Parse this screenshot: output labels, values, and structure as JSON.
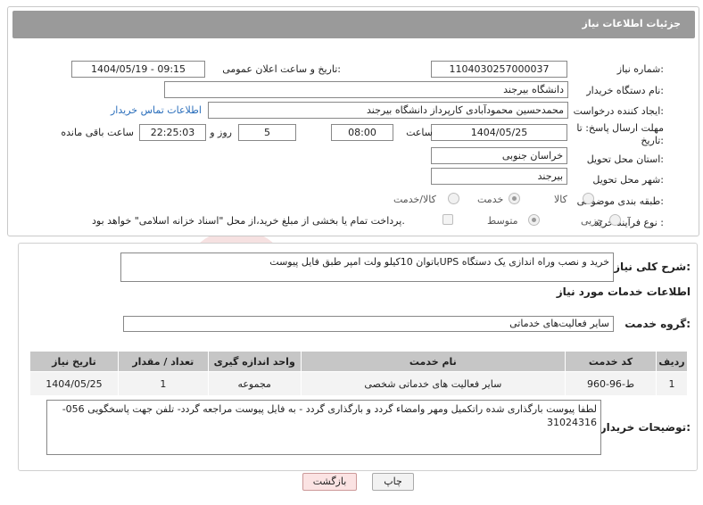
{
  "header": {
    "title": "جزئیات اطلاعات نیاز"
  },
  "labels": {
    "need_number": "شماره نیاز:",
    "public_announce": "تاریخ و ساعت اعلان عمومی:",
    "buyer_org": "نام دستگاه خریدار:",
    "requester": "ایجاد کننده درخواست:",
    "deadline": "مهلت ارسال پاسخ: تا تاریخ:",
    "time_word": "ساعت",
    "day_and": "روز و",
    "remaining": "ساعت باقی مانده",
    "province": "استان محل تحویل:",
    "city": "شهر محل تحویل:",
    "category": "طبقه بندی موضوعی:",
    "process": "نوع فرآیند خرید :"
  },
  "values": {
    "need_number": "1104030257000037",
    "public_announce": "1404/05/19 - 09:15",
    "buyer_org": "دانشگاه بیرجند",
    "requester": "محمدحسین محمودآبادی کارپرداز دانشگاه بیرجند",
    "deadline_date": "1404/05/25",
    "deadline_time": "08:00",
    "days": "5",
    "remaining_time": "22:25:03",
    "province": "خراسان جنوبی",
    "city": "بیرجند"
  },
  "contact_link": "اطلاعات تماس خریدار",
  "category_options": [
    "کالا",
    "خدمت",
    "کالا/خدمت"
  ],
  "category_selected": "خدمت",
  "process_options": [
    "جزیی",
    "متوسط"
  ],
  "process_selected": "متوسط",
  "payment_note": "پرداخت تمام یا بخشی از مبلغ خرید،از محل \"اسناد خزانه اسلامی\" خواهد بود.",
  "general_desc": {
    "label": "شرح کلی نیاز:",
    "value": "خرید و نصب وراه اندازی یک دستگاه UPSباتوان 10کیلو ولت امپر طبق فایل پیوست"
  },
  "services_title": "اطلاعات خدمات مورد نیاز",
  "service_group": {
    "label": "گروه خدمت:",
    "value": "سایر فعالیت‌های خدماتی"
  },
  "table": {
    "headers": [
      "ردیف",
      "کد خدمت",
      "نام خدمت",
      "واحد اندازه گیری",
      "تعداد / مقدار",
      "تاریخ نیاز"
    ],
    "rows": [
      [
        "1",
        "ط-96-960",
        "سایر فعالیت های خدماتی شخصی",
        "مجموعه",
        "1",
        "1404/05/25"
      ]
    ]
  },
  "buyer_notes": {
    "label": "توضیحات خریدار:",
    "value": "لطفا پیوست بارگذاری شده راتکمیل ومهر وامضاء گردد  و بارگذاری گردد - به فایل پیوست مراجعه گردد- تلفن جهت پاسخگویی 056-31024316"
  },
  "buttons": {
    "print": "چاپ",
    "back": "بازگشت"
  },
  "watermark_text": "AriaTender.neT"
}
